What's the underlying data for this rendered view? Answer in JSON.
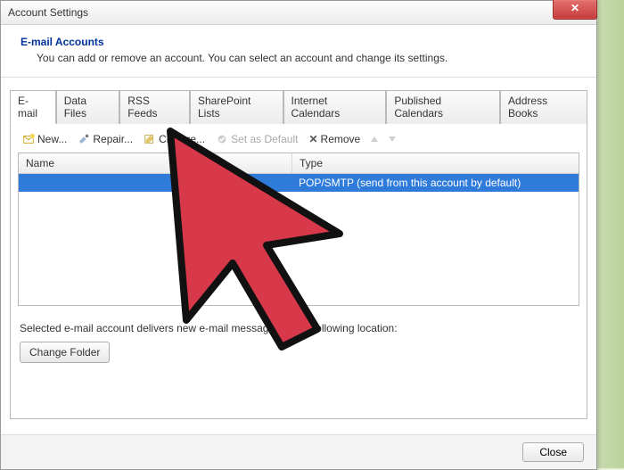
{
  "window": {
    "title": "Account Settings",
    "close_x_label": "✕"
  },
  "header": {
    "title": "E-mail Accounts",
    "desc": "You can add or remove an account. You can select an account and change its settings."
  },
  "tabs": [
    "E-mail",
    "Data Files",
    "RSS Feeds",
    "SharePoint Lists",
    "Internet Calendars",
    "Published Calendars",
    "Address Books"
  ],
  "toolbar": {
    "new": "New...",
    "repair": "Repair...",
    "change": "Change...",
    "set_default": "Set as Default",
    "remove": "Remove"
  },
  "list": {
    "columns": {
      "name": "Name",
      "type": "Type"
    },
    "rows": [
      {
        "name": "",
        "type": "POP/SMTP (send from this account by default)"
      }
    ]
  },
  "below_text": "Selected e-mail account delivers new e-mail messages to the following location:",
  "change_folder_label": "Change Folder",
  "close_label": "Close"
}
